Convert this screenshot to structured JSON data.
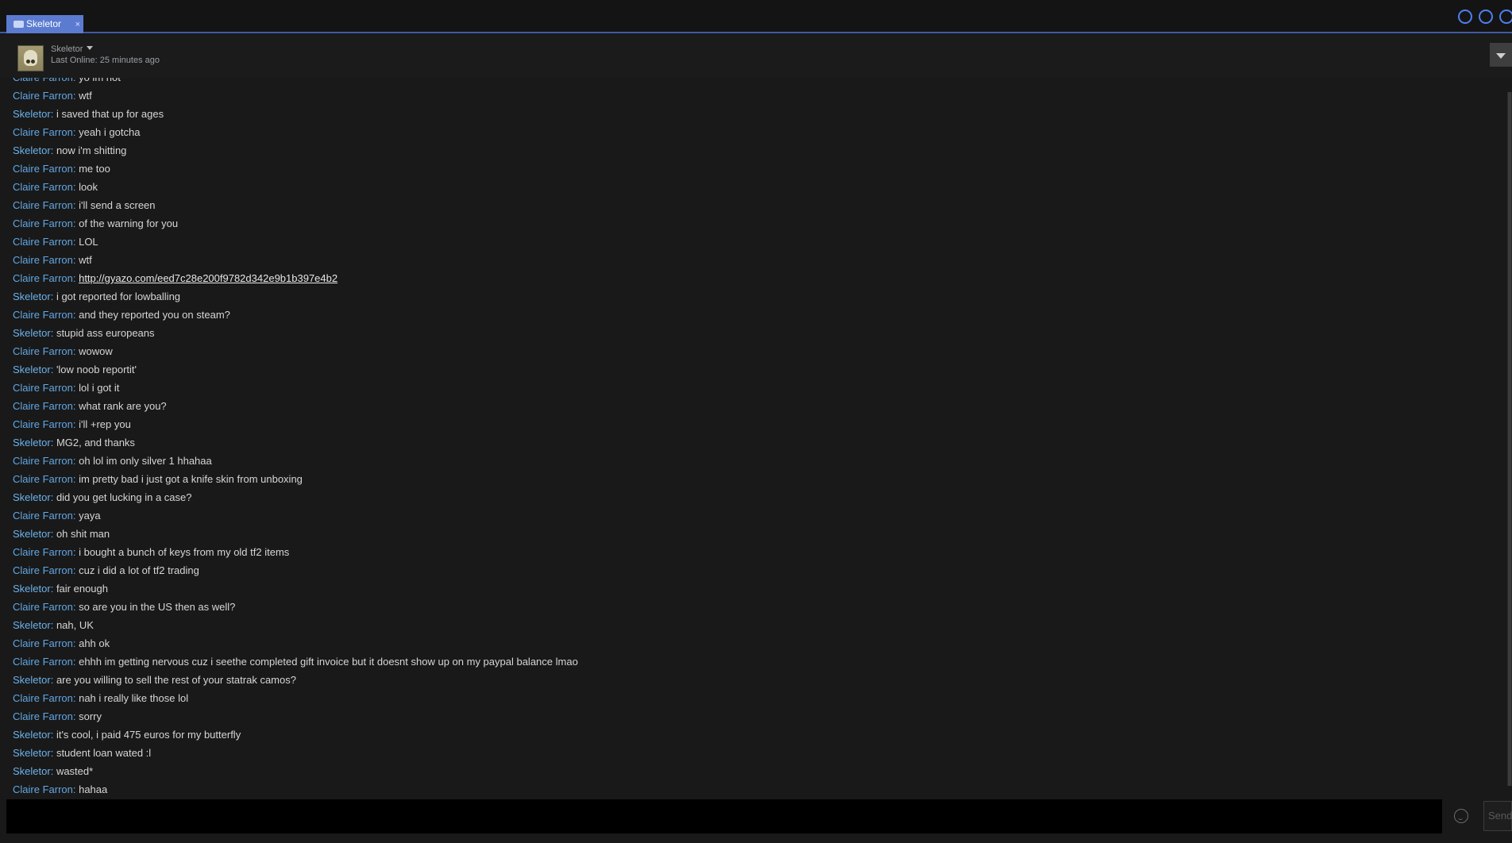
{
  "tab": {
    "label": "Skeletor",
    "close": "×"
  },
  "header": {
    "name": "Skeletor",
    "last_online": "Last Online: 25 minutes ago"
  },
  "messages": [
    {
      "sender": "Claire Farron:",
      "text": "yo im not",
      "me": false
    },
    {
      "sender": "Claire Farron:",
      "text": "wtf",
      "me": false
    },
    {
      "sender": "Skeletor:",
      "text": "i saved that up for ages",
      "me": true
    },
    {
      "sender": "Claire Farron:",
      "text": "yeah i gotcha",
      "me": false
    },
    {
      "sender": "Skeletor:",
      "text": "now i'm shitting",
      "me": true
    },
    {
      "sender": "Claire Farron:",
      "text": "me too",
      "me": false
    },
    {
      "sender": "Claire Farron:",
      "text": "look",
      "me": false
    },
    {
      "sender": "Claire Farron:",
      "text": "i'll send a screen",
      "me": false
    },
    {
      "sender": "Claire Farron:",
      "text": "of the warning for you",
      "me": false
    },
    {
      "sender": "Claire Farron:",
      "text": "LOL",
      "me": false
    },
    {
      "sender": "Claire Farron:",
      "text": "wtf",
      "me": false
    },
    {
      "sender": "Claire Farron:",
      "text": "http://gyazo.com/eed7c28e200f9782d342e9b1b397e4b2",
      "me": false,
      "link": true
    },
    {
      "sender": "Skeletor:",
      "text": "i got reported for lowballing",
      "me": true
    },
    {
      "sender": "Claire Farron:",
      "text": "and they reported you on steam?",
      "me": false
    },
    {
      "sender": "Skeletor:",
      "text": "stupid ass europeans",
      "me": true
    },
    {
      "sender": "Claire Farron:",
      "text": "wowow",
      "me": false
    },
    {
      "sender": "Skeletor:",
      "text": "'low noob reportit'",
      "me": true
    },
    {
      "sender": "Claire Farron:",
      "text": "lol i got it",
      "me": false
    },
    {
      "sender": "Claire Farron:",
      "text": "what rank are you?",
      "me": false
    },
    {
      "sender": "Claire Farron:",
      "text": "i'll +rep you",
      "me": false
    },
    {
      "sender": "Skeletor:",
      "text": "MG2, and thanks",
      "me": true
    },
    {
      "sender": "Claire Farron:",
      "text": "oh lol im only silver 1 hhahaa",
      "me": false
    },
    {
      "sender": "Claire Farron:",
      "text": "im pretty bad i just got a knife skin from unboxing",
      "me": false
    },
    {
      "sender": "Skeletor:",
      "text": "did you get lucking in a case?",
      "me": true
    },
    {
      "sender": "Claire Farron:",
      "text": "yaya",
      "me": false
    },
    {
      "sender": "Skeletor:",
      "text": "oh shit man",
      "me": true
    },
    {
      "sender": "Claire Farron:",
      "text": "i bought a bunch of keys from my old tf2 items",
      "me": false
    },
    {
      "sender": "Claire Farron:",
      "text": "cuz i did a lot of tf2 trading",
      "me": false
    },
    {
      "sender": "Skeletor:",
      "text": "fair enough",
      "me": true
    },
    {
      "sender": "Claire Farron:",
      "text": "so are you in the US then as well?",
      "me": false
    },
    {
      "sender": "Skeletor:",
      "text": "nah, UK",
      "me": true
    },
    {
      "sender": "Claire Farron:",
      "text": "ahh ok",
      "me": false
    },
    {
      "sender": "Claire Farron:",
      "text": "ehhh im getting nervous cuz i seethe completed gift invoice but it doesnt show up on my paypal balance lmao",
      "me": false
    },
    {
      "sender": "Skeletor:",
      "text": "are you willing to sell the rest of your statrak camos?",
      "me": true
    },
    {
      "sender": "Claire Farron:",
      "text": "nah i really like those lol",
      "me": false
    },
    {
      "sender": "Claire Farron:",
      "text": "sorry",
      "me": false
    },
    {
      "sender": "Skeletor:",
      "text": "it's cool, i paid 475 euros for my butterfly",
      "me": true
    },
    {
      "sender": "Skeletor:",
      "text": "student loan wated :l",
      "me": true
    },
    {
      "sender": "Skeletor:",
      "text": "wasted*",
      "me": true
    },
    {
      "sender": "Claire Farron:",
      "text": "hahaa",
      "me": false
    }
  ],
  "input": {
    "value": "",
    "send_label": "Send"
  },
  "colors": {
    "accent": "#5a7bd0",
    "sender": "#62a7e3",
    "background": "#191919"
  }
}
